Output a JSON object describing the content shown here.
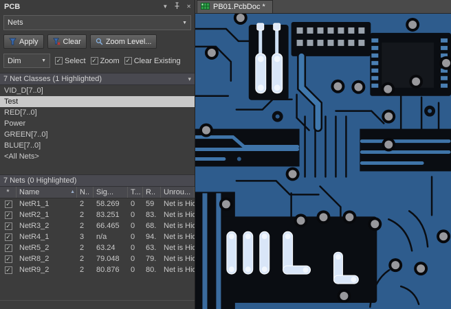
{
  "panel": {
    "title": "PCB",
    "mode_select": "Nets",
    "toolbar": {
      "apply": "Apply",
      "clear": "Clear",
      "zoom_level": "Zoom Level..."
    },
    "options": {
      "dim": "Dim",
      "select": "Select",
      "zoom": "Zoom",
      "clear_existing": "Clear Existing"
    },
    "net_classes": {
      "header": "7 Net Classes (1 Highlighted)",
      "items": [
        {
          "label": "VID_D[7..0]",
          "selected": false
        },
        {
          "label": "Test",
          "selected": true
        },
        {
          "label": "RED[7..0]",
          "selected": false
        },
        {
          "label": "Power",
          "selected": false
        },
        {
          "label": "GREEN[7..0]",
          "selected": false
        },
        {
          "label": "BLUE[7..0]",
          "selected": false
        },
        {
          "label": "<All Nets>",
          "selected": false
        }
      ]
    },
    "nets": {
      "header": "7 Nets (0 Highlighted)",
      "columns": {
        "check": "*",
        "name": "Name",
        "nodes": "N..",
        "signal": "Sig...",
        "t": "T...",
        "routed": "R..",
        "unrouted": "Unrou..."
      },
      "rows": [
        {
          "checked": true,
          "name": "NetR1_1",
          "nodes": "2",
          "signal": "58.269",
          "t": "0",
          "routed": "59",
          "unrouted": "Net is Hid"
        },
        {
          "checked": true,
          "name": "NetR2_1",
          "nodes": "2",
          "signal": "83.251",
          "t": "0",
          "routed": "83.",
          "unrouted": "Net is Hid"
        },
        {
          "checked": true,
          "name": "NetR3_2",
          "nodes": "2",
          "signal": "66.465",
          "t": "0",
          "routed": "68.",
          "unrouted": "Net is Hid"
        },
        {
          "checked": true,
          "name": "NetR4_1",
          "nodes": "3",
          "signal": "n/a",
          "t": "0",
          "routed": "94.",
          "unrouted": "Net is Hid"
        },
        {
          "checked": true,
          "name": "NetR5_2",
          "nodes": "2",
          "signal": "63.24",
          "t": "0",
          "routed": "63.",
          "unrouted": "Net is Hid"
        },
        {
          "checked": true,
          "name": "NetR8_2",
          "nodes": "2",
          "signal": "79.048",
          "t": "0",
          "routed": "79.",
          "unrouted": "Net is Hid"
        },
        {
          "checked": true,
          "name": "NetR9_2",
          "nodes": "2",
          "signal": "80.876",
          "t": "0",
          "routed": "80.",
          "unrouted": "Net is Hid"
        }
      ]
    }
  },
  "editor": {
    "tab_label": "PB01.PcbDoc *"
  },
  "icons": {
    "dropdown_arrow": "▼",
    "section_arrow": "▾",
    "sort_asc": "▲",
    "close": "✕",
    "check": "✓"
  },
  "colors": {
    "panel_bg": "#3c3c3c",
    "selection_bg": "#c9c9c9",
    "copper_blue": "#2e5c8d",
    "highlight": "#d9e6f8",
    "via_gray": "#98989c",
    "board_black": "#0a0d12"
  }
}
